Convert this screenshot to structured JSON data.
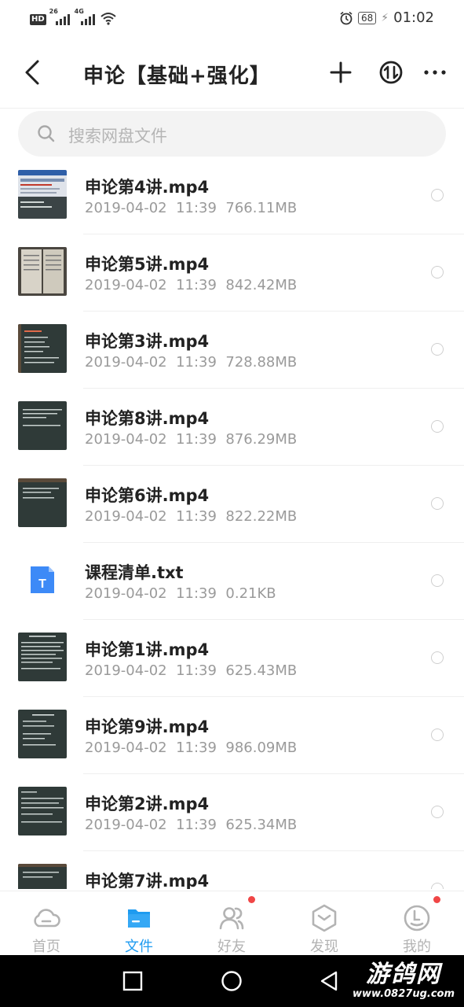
{
  "status_bar": {
    "hd_label": "HD",
    "net1": "26",
    "net2": "4G",
    "battery": "68",
    "time": "01:02"
  },
  "header": {
    "title": "申论【基础+强化】"
  },
  "search": {
    "placeholder": "搜索网盘文件"
  },
  "files": [
    {
      "name": "申论第4讲.mp4",
      "date": "2019-04-02",
      "time": "11:39",
      "size": "766.11MB",
      "thumb": "video-a"
    },
    {
      "name": "申论第5讲.mp4",
      "date": "2019-04-02",
      "time": "11:39",
      "size": "842.42MB",
      "thumb": "paper"
    },
    {
      "name": "申论第3讲.mp4",
      "date": "2019-04-02",
      "time": "11:39",
      "size": "728.88MB",
      "thumb": "board"
    },
    {
      "name": "申论第8讲.mp4",
      "date": "2019-04-02",
      "time": "11:39",
      "size": "876.29MB",
      "thumb": "board"
    },
    {
      "name": "申论第6讲.mp4",
      "date": "2019-04-02",
      "time": "11:39",
      "size": "822.22MB",
      "thumb": "board"
    },
    {
      "name": "课程清单.txt",
      "date": "2019-04-02",
      "time": "11:39",
      "size": "0.21KB",
      "thumb": "txt"
    },
    {
      "name": "申论第1讲.mp4",
      "date": "2019-04-02",
      "time": "11:39",
      "size": "625.43MB",
      "thumb": "board"
    },
    {
      "name": "申论第9讲.mp4",
      "date": "2019-04-02",
      "time": "11:39",
      "size": "986.09MB",
      "thumb": "board"
    },
    {
      "name": "申论第2讲.mp4",
      "date": "2019-04-02",
      "time": "11:39",
      "size": "625.34MB",
      "thumb": "board"
    },
    {
      "name": "申论第7讲.mp4",
      "date": "",
      "time": "",
      "size": "",
      "thumb": "board"
    }
  ],
  "txt_icon_letter": "T",
  "bottom_nav": [
    {
      "label": "首页",
      "icon": "cloud-icon",
      "active": false,
      "dot": false
    },
    {
      "label": "文件",
      "icon": "folder-icon",
      "active": true,
      "dot": false
    },
    {
      "label": "好友",
      "icon": "friends-icon",
      "active": false,
      "dot": true
    },
    {
      "label": "发现",
      "icon": "discover-icon",
      "active": false,
      "dot": false
    },
    {
      "label": "我的",
      "icon": "profile-icon",
      "active": false,
      "dot": true
    }
  ],
  "watermark": {
    "big": "游鸽网",
    "small": "www.0827ug.com"
  },
  "colors": {
    "accent": "#1e9bf0",
    "badge": "#f04646",
    "txt_icon": "#3d8af7",
    "board": "#2f3a38"
  }
}
